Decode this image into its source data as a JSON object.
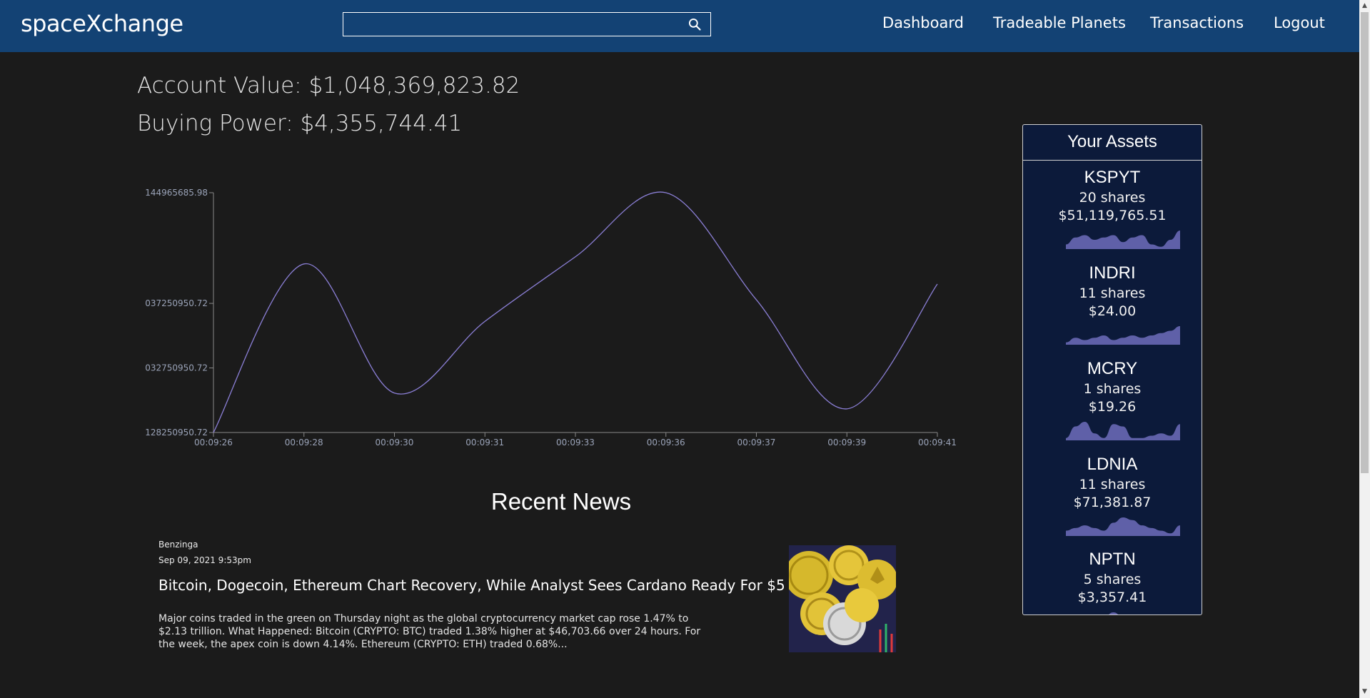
{
  "app": {
    "brand": "spaceXchange"
  },
  "search": {
    "placeholder": "",
    "value": ""
  },
  "nav": {
    "dashboard": "Dashboard",
    "tradeable_planets": "Tradeable Planets",
    "transactions": "Transactions",
    "logout": "Logout"
  },
  "account": {
    "value_text": "Account Value: $1,048,369,823.82",
    "buying_power_text": "Buying Power: $4,355,744.41"
  },
  "chart_data": {
    "type": "line",
    "title": "",
    "xlabel": "",
    "ylabel": "",
    "x": [
      "00:09:26",
      "00:09:28",
      "00:09:30",
      "00:09:31",
      "00:09:33",
      "00:09:36",
      "00:09:37",
      "00:09:39",
      "00:09:41"
    ],
    "series": [
      {
        "values": [
          1028250950.72,
          1040000000,
          1031000000,
          1036000000,
          1040500000,
          1044965685.98,
          1037500000,
          1029900000,
          1038600000
        ]
      }
    ],
    "y_ticks": [
      "144965685.98",
      "037250950.72",
      "032750950.72",
      "128250950.72"
    ],
    "y_tick_values": [
      1044965685.98,
      1037250950.72,
      1032750950.72,
      1028250950.72
    ],
    "ylim": [
      1028250950.72,
      1044965685.98
    ],
    "grid": false,
    "line_color": "#8b7fd6",
    "axis_color": "#8a8a8a"
  },
  "news": {
    "heading": "Recent News",
    "items": [
      {
        "source": "Benzinga",
        "date": "Sep 09, 2021 9:53pm",
        "title": "Bitcoin, Dogecoin, Ethereum Chart Recovery, While Analyst Sees Cardano Ready For $5",
        "summary": "Major coins traded in the green on Thursday night as the global cryptocurrency market cap rose 1.47% to $2.13 trillion. What Happened: Bitcoin (CRYPTO: BTC) traded 1.38% higher at $46,703.66 over 24 hours. For the week, the apex coin  is down 4.14%. Ethereum (CRYPTO: ETH) traded 0.68%...",
        "image_icon": "crypto-coins-image"
      }
    ]
  },
  "assets": {
    "title": "Your Assets",
    "items": [
      {
        "symbol": "KSPYT",
        "shares": "20 shares",
        "value": "$51,119,765.51",
        "spark": [
          2,
          5,
          6,
          4,
          5,
          6,
          3,
          5,
          6,
          2,
          1,
          4,
          8
        ]
      },
      {
        "symbol": "INDRI",
        "shares": "11 shares",
        "value": "$24.00",
        "spark": [
          1,
          3,
          2,
          3,
          4,
          2,
          3,
          4,
          3,
          4,
          5,
          6,
          8
        ]
      },
      {
        "symbol": "MCRY",
        "shares": "1 shares",
        "value": "$19.26",
        "spark": [
          1,
          6,
          8,
          3,
          1,
          7,
          6,
          1,
          1,
          2,
          3,
          2,
          7
        ]
      },
      {
        "symbol": "LDNIA",
        "shares": "11 shares",
        "value": "$71,381.87",
        "spark": [
          2,
          3,
          4,
          3,
          2,
          5,
          7,
          6,
          4,
          3,
          2,
          1,
          4
        ]
      },
      {
        "symbol": "NPTN",
        "shares": "5 shares",
        "value": "$3,357.41",
        "spark": [
          1,
          1,
          2,
          2,
          3,
          4,
          3,
          2,
          2,
          1,
          1,
          1,
          1
        ]
      }
    ],
    "spark_color": "#5f60a8"
  }
}
